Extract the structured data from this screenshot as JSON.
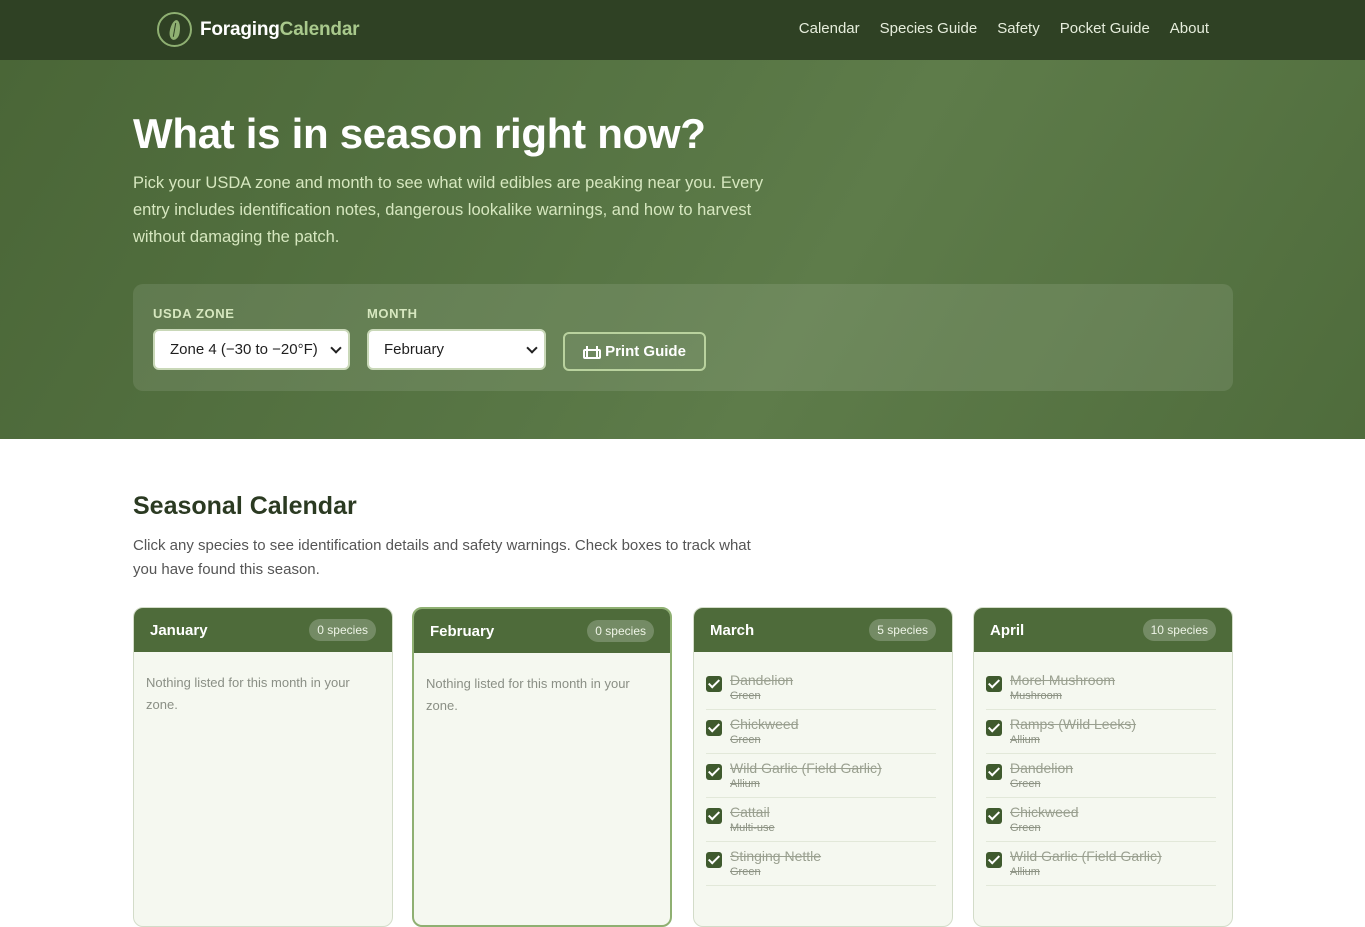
{
  "brand": {
    "part1": "Foraging",
    "part2": "Calendar"
  },
  "nav": [
    "Calendar",
    "Species Guide",
    "Safety",
    "Pocket Guide",
    "About"
  ],
  "hero": {
    "title": "What is in season right now?",
    "subtitle": "Pick your USDA zone and month to see what wild edibles are peaking near you. Every entry includes identification notes, dangerous lookalike warnings, and how to harvest without damaging the patch."
  },
  "filters": {
    "zone_label": "USDA ZONE",
    "zone_value": "Zone 4 (−30 to −20°F)",
    "month_label": "MONTH",
    "month_value": "February",
    "print_label": "Print Guide"
  },
  "calendar": {
    "title": "Seasonal Calendar",
    "description": "Click any species to see identification details and safety warnings. Check boxes to track what you have found this season.",
    "months": [
      {
        "name": "January",
        "count": "0 species",
        "empty": "Nothing listed for this month in your zone.",
        "items": []
      },
      {
        "name": "February",
        "count": "0 species",
        "empty": "Nothing listed for this month in your zone.",
        "items": []
      },
      {
        "name": "March",
        "count": "5 species",
        "empty": "",
        "items": [
          {
            "name": "Dandelion",
            "category": "Green"
          },
          {
            "name": "Chickweed",
            "category": "Green"
          },
          {
            "name": "Wild Garlic (Field Garlic)",
            "category": "Allium"
          },
          {
            "name": "Cattail",
            "category": "Multi-use"
          },
          {
            "name": "Stinging Nettle",
            "category": "Green"
          }
        ]
      },
      {
        "name": "April",
        "count": "10 species",
        "empty": "",
        "items": [
          {
            "name": "Morel Mushroom",
            "category": "Mushroom"
          },
          {
            "name": "Ramps (Wild Leeks)",
            "category": "Allium"
          },
          {
            "name": "Dandelion",
            "category": "Green"
          },
          {
            "name": "Chickweed",
            "category": "Green"
          },
          {
            "name": "Wild Garlic (Field Garlic)",
            "category": "Allium"
          }
        ]
      }
    ]
  },
  "colors": {
    "header": "#2f4124",
    "hero": "#587645",
    "accent": "#8fb072",
    "card_head": "#4e6b3a"
  },
  "icons": {
    "logo": "leaf-icon",
    "print": "printer-icon",
    "select": "chevron-down-icon",
    "checkbox": "checkmark-icon"
  }
}
